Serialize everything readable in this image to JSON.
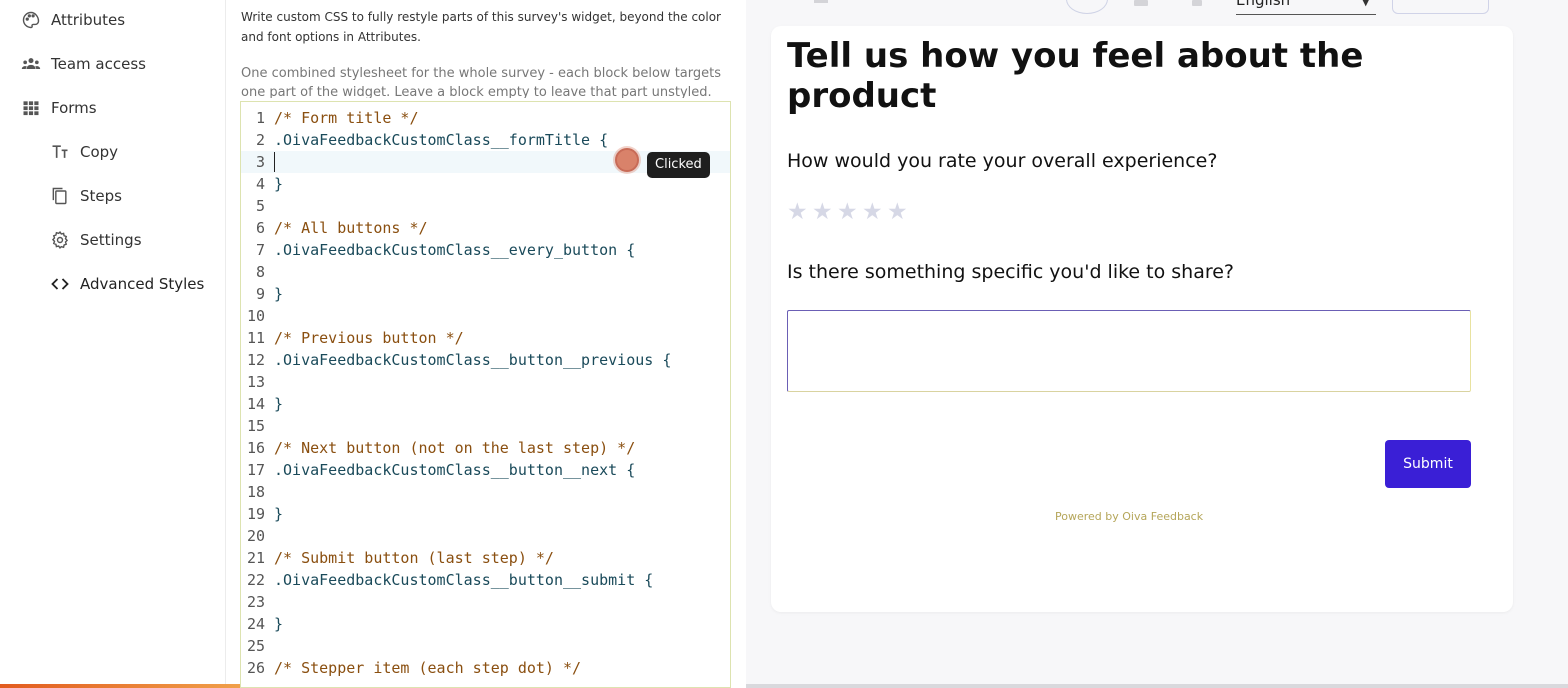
{
  "sidebar": {
    "items": [
      {
        "label": "Attributes",
        "icon": "palette-icon"
      },
      {
        "label": "Team access",
        "icon": "users-icon"
      },
      {
        "label": "Forms",
        "icon": "grid-icon"
      },
      {
        "label": "Copy",
        "icon": "text-icon"
      },
      {
        "label": "Steps",
        "icon": "copy-icon"
      },
      {
        "label": "Settings",
        "icon": "gear-icon"
      },
      {
        "label": "Advanced Styles",
        "icon": "code-icon"
      }
    ]
  },
  "editor": {
    "description": "Write custom CSS to fully restyle parts of this survey's widget, beyond the color and font options in Attributes.",
    "sub_description": "One combined stylesheet for the whole survey - each block below targets one part of the widget. Leave a block empty to leave that part unstyled.",
    "lines": [
      {
        "n": "1",
        "text": "/* Form title */",
        "type": "comment"
      },
      {
        "n": "2",
        "text": ".OivaFeedbackCustomClass__formTitle {",
        "type": "code"
      },
      {
        "n": "3",
        "text": "",
        "type": "code"
      },
      {
        "n": "4",
        "text": "}",
        "type": "code"
      },
      {
        "n": "5",
        "text": "",
        "type": "code"
      },
      {
        "n": "6",
        "text": "/* All buttons */",
        "type": "comment"
      },
      {
        "n": "7",
        "text": ".OivaFeedbackCustomClass__every_button {",
        "type": "code"
      },
      {
        "n": "8",
        "text": "",
        "type": "code"
      },
      {
        "n": "9",
        "text": "}",
        "type": "code"
      },
      {
        "n": "10",
        "text": "",
        "type": "code"
      },
      {
        "n": "11",
        "text": "/* Previous button */",
        "type": "comment"
      },
      {
        "n": "12",
        "text": ".OivaFeedbackCustomClass__button__previous {",
        "type": "code"
      },
      {
        "n": "13",
        "text": "",
        "type": "code"
      },
      {
        "n": "14",
        "text": "}",
        "type": "code"
      },
      {
        "n": "15",
        "text": "",
        "type": "code"
      },
      {
        "n": "16",
        "text": "/* Next button (not on the last step) */",
        "type": "comment"
      },
      {
        "n": "17",
        "text": ".OivaFeedbackCustomClass__button__next {",
        "type": "code"
      },
      {
        "n": "18",
        "text": "",
        "type": "code"
      },
      {
        "n": "19",
        "text": "}",
        "type": "code"
      },
      {
        "n": "20",
        "text": "",
        "type": "code"
      },
      {
        "n": "21",
        "text": "/* Submit button (last step) */",
        "type": "comment"
      },
      {
        "n": "22",
        "text": ".OivaFeedbackCustomClass__button__submit {",
        "type": "code"
      },
      {
        "n": "23",
        "text": "",
        "type": "code"
      },
      {
        "n": "24",
        "text": "}",
        "type": "code"
      },
      {
        "n": "25",
        "text": "",
        "type": "code"
      },
      {
        "n": "26",
        "text": "/* Stepper item (each step dot) */",
        "type": "comment"
      }
    ],
    "active_line": "3",
    "tooltip": "Clicked"
  },
  "preview": {
    "language": "English",
    "form_title": "Tell us how you feel about the product",
    "question1": "How would you rate your overall experience?",
    "rating_max": 5,
    "rating_value": 0,
    "question2": "Is there something specific you'd like to share?",
    "answer_value": "",
    "submit_label": "Submit",
    "powered_by": "Powered by Oiva Feedback"
  },
  "colors": {
    "accent": "#3a1fd6",
    "comment": "#8a4f10",
    "code": "#1a4a5a",
    "star_empty": "#d6d8e6"
  }
}
